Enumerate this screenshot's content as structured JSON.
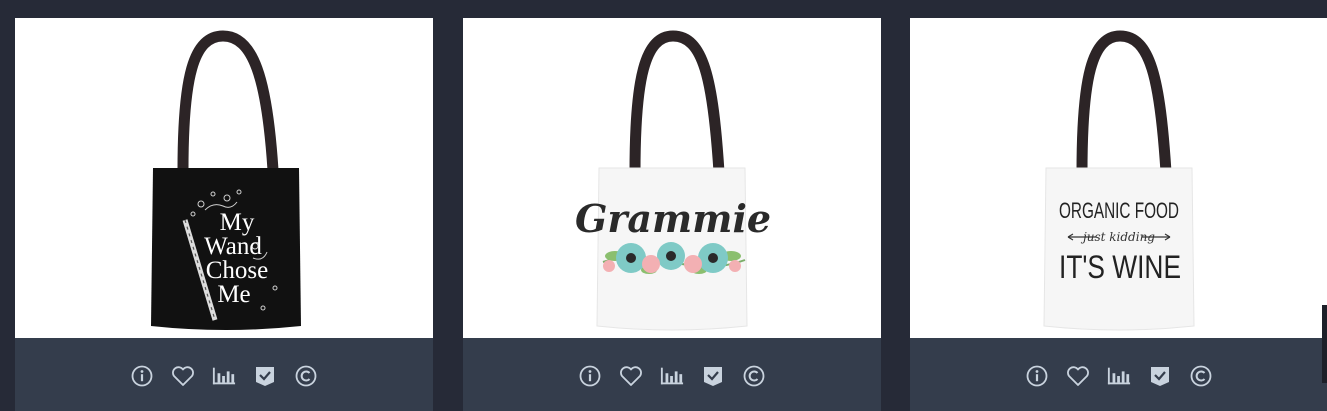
{
  "products": [
    {
      "id": "p1",
      "theme": "black",
      "design_lines": [
        "My",
        "Wand",
        "Chose",
        "Me"
      ],
      "actions": [
        "info-icon",
        "heart-icon",
        "chart-icon",
        "shield-check-icon",
        "copyright-icon"
      ]
    },
    {
      "id": "p2",
      "theme": "white",
      "design_lines": [
        "Grammie"
      ],
      "actions": [
        "info-icon",
        "heart-icon",
        "chart-icon",
        "shield-check-icon",
        "copyright-icon"
      ]
    },
    {
      "id": "p3",
      "theme": "white",
      "design_lines": [
        "ORGANIC FOOD",
        "just kidding",
        "IT'S WINE"
      ],
      "actions": [
        "info-icon",
        "heart-icon",
        "chart-icon",
        "shield-check-icon",
        "copyright-icon"
      ]
    }
  ],
  "colors": {
    "page_bg": "#262a37",
    "card_footer": "#343d4c",
    "icon": "#c9d3de",
    "bag_black": "#111111",
    "bag_white": "#f6f6f6",
    "strap": "#2c2426",
    "flower_teal": "#7fcac6",
    "flower_pink": "#f3b0b3"
  }
}
